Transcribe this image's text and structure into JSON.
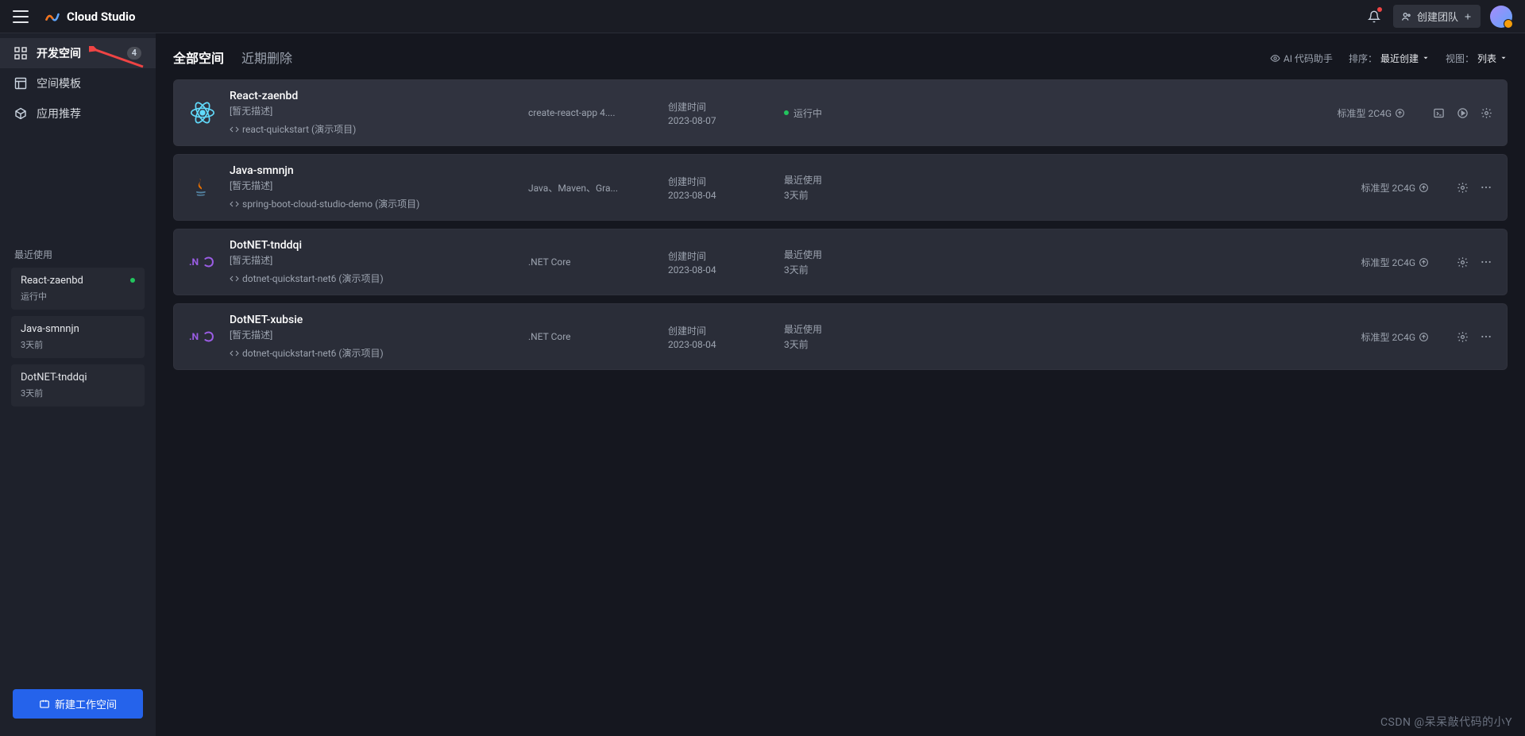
{
  "header": {
    "app_name": "Cloud Studio",
    "create_team_label": "创建团队"
  },
  "sidebar": {
    "nav": [
      {
        "label": "开发空间",
        "badge": "4"
      },
      {
        "label": "空间模板"
      },
      {
        "label": "应用推荐"
      }
    ],
    "recent_header": "最近使用",
    "recent": [
      {
        "name": "React-zaenbd",
        "sub": "运行中",
        "running": true
      },
      {
        "name": "Java-smnnjn",
        "sub": "3天前",
        "running": false
      },
      {
        "name": "DotNET-tnddqi",
        "sub": "3天前",
        "running": false
      }
    ],
    "new_ws_label": "新建工作空间"
  },
  "main": {
    "tabs": [
      {
        "label": "全部空间",
        "active": true
      },
      {
        "label": "近期删除",
        "active": false
      }
    ],
    "controls": {
      "ai_label": "AI 代码助手",
      "sort_label": "排序：",
      "sort_value": "最近创建",
      "view_label": "视图：",
      "view_value": "列表"
    },
    "workspaces": [
      {
        "name": "React-zaenbd",
        "desc": "[暂无描述]",
        "template": "react-quickstart (演示项目)",
        "tech": "create-react-app 4....",
        "time_label": "创建时间",
        "time_value": "2023-08-07",
        "status_kind": "running",
        "status_text": "运行中",
        "spec": "标准型 2C4G",
        "icon": "react",
        "actions": [
          "terminal",
          "play",
          "gear"
        ]
      },
      {
        "name": "Java-smnnjn",
        "desc": "[暂无描述]",
        "template": "spring-boot-cloud-studio-demo (演示项目)",
        "tech": "Java、Maven、Gra...",
        "time_label": "创建时间",
        "time_value": "2023-08-04",
        "status_kind": "last",
        "status_label": "最近使用",
        "status_text": "3天前",
        "spec": "标准型 2C4G",
        "icon": "java",
        "actions": [
          "gear",
          "more"
        ]
      },
      {
        "name": "DotNET-tnddqi",
        "desc": "[暂无描述]",
        "template": "dotnet-quickstart-net6 (演示项目)",
        "tech": ".NET Core",
        "time_label": "创建时间",
        "time_value": "2023-08-04",
        "status_kind": "last",
        "status_label": "最近使用",
        "status_text": "3天前",
        "spec": "标准型 2C4G",
        "icon": "dotnet",
        "actions": [
          "gear",
          "more"
        ]
      },
      {
        "name": "DotNET-xubsie",
        "desc": "[暂无描述]",
        "template": "dotnet-quickstart-net6 (演示项目)",
        "tech": ".NET Core",
        "time_label": "创建时间",
        "time_value": "2023-08-04",
        "status_kind": "last",
        "status_label": "最近使用",
        "status_text": "3天前",
        "spec": "标准型 2C4G",
        "icon": "dotnet",
        "actions": [
          "gear",
          "more"
        ]
      }
    ]
  },
  "watermark": "CSDN @呆呆敲代码的小Y"
}
